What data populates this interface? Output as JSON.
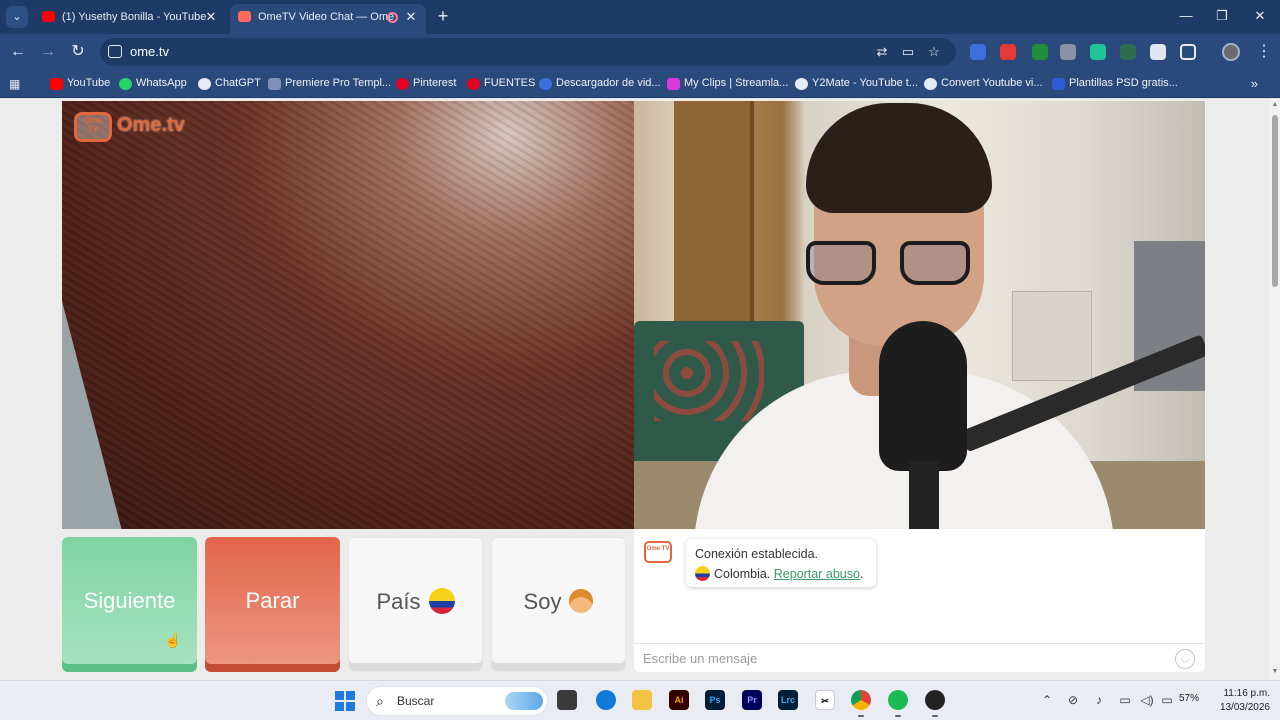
{
  "browser": {
    "tabs": [
      {
        "title": "(1) Yusethy Bonilla - YouTube",
        "active": false
      },
      {
        "title": "OmeTV Video Chat — Ome",
        "active": true
      }
    ],
    "url": "ome.tv",
    "bookmarks": [
      {
        "label": "YouTube",
        "icon": "youtube-icon",
        "color": "#ff0000"
      },
      {
        "label": "WhatsApp",
        "icon": "whatsapp-icon",
        "color": "#25d366"
      },
      {
        "label": "ChatGPT",
        "icon": "chatgpt-icon",
        "color": "#e6ecf6"
      },
      {
        "label": "Premiere Pro Templ...",
        "icon": "flag-icon",
        "color": "#7e8fb8"
      },
      {
        "label": "Pinterest",
        "icon": "pinterest-icon",
        "color": "#e60023"
      },
      {
        "label": "FUENTES",
        "icon": "pinterest-icon",
        "color": "#e60023"
      },
      {
        "label": "Descargador de vid...",
        "icon": "s-icon",
        "color": "#3b6fd9"
      },
      {
        "label": "My Clips | Streamla...",
        "icon": "streamlabs-icon",
        "color": "#d63ad8"
      },
      {
        "label": "Y2Mate - YouTube t...",
        "icon": "y2mate-icon",
        "color": "#e6ecf6"
      },
      {
        "label": "Convert Youtube vi...",
        "icon": "convert-icon",
        "color": "#e6ecf6"
      },
      {
        "label": "Plantillas PSD gratis...",
        "icon": "psd-icon",
        "color": "#2f5ad6"
      }
    ]
  },
  "page": {
    "logo": {
      "tv_text": "Ome\nTV",
      "brand": "Ome.tv",
      "color": "#e0683c"
    },
    "buttons": {
      "next": "Siguiente",
      "stop": "Parar",
      "country": "País",
      "gender": "Soy"
    },
    "chat": {
      "logo_text": "Ome TV",
      "message_line1": "Conexión establecida.",
      "country": "Colombia.",
      "report_link": "Reportar abuso",
      "period": ".",
      "input_placeholder": "Escribe un mensaje"
    },
    "colors": {
      "next": "#7fd4a2",
      "stop": "#e2654c",
      "link": "#3a9a6a"
    }
  },
  "taskbar": {
    "search_label": "Buscar",
    "apps": [
      "File Explorer",
      "Edge",
      "Folder",
      "Illustrator",
      "Photoshop",
      "Premiere Pro",
      "Lightroom Classic",
      "CapCut",
      "Chrome",
      "Spotify",
      "ChatGPT"
    ],
    "battery": "57%",
    "time": "11:16 p.m.",
    "date": "13/03/2026"
  }
}
